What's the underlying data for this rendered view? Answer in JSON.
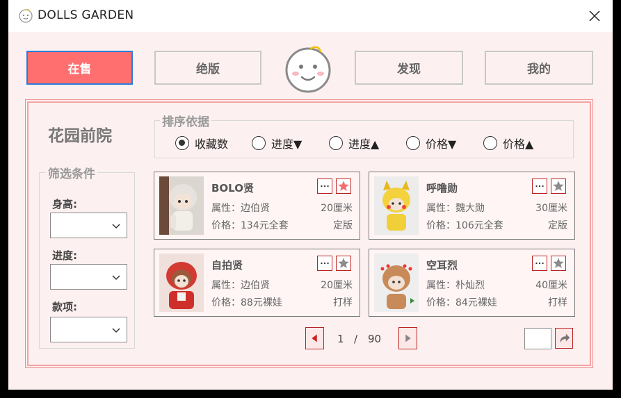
{
  "app": {
    "title": "DOLLS GARDEN"
  },
  "nav": {
    "on_sale": "在售",
    "out_of_print": "绝版",
    "discover": "发现",
    "mine": "我的"
  },
  "colors": {
    "accent": "#ff6f6f",
    "border_red": "#b22222",
    "panel_border": "#f5a3a3",
    "bg": "#fdf0f0"
  },
  "sidebar": {
    "title": "花园前院",
    "filter_legend": "筛选条件",
    "height_label": "身高:",
    "progress_label": "进度:",
    "type_label": "款项:"
  },
  "sort": {
    "legend": "排序依据",
    "options": [
      "收藏数",
      "进度▼",
      "进度▲",
      "价格▼",
      "价格▲"
    ],
    "selected": "收藏数"
  },
  "cards": [
    {
      "name": "BOLO贤",
      "attr": "属性：边伯贤",
      "size": "20厘米",
      "price": "价格：134元全套",
      "status": "定版",
      "favorited": true
    },
    {
      "name": "呼噜勋",
      "attr": "属性：魏大勋",
      "size": "30厘米",
      "price": "价格：106元全套",
      "status": "定版",
      "favorited": false
    },
    {
      "name": "自拍贤",
      "attr": "属性：边伯贤",
      "size": "20厘米",
      "price": "价格：88元裸娃",
      "status": "打样",
      "favorited": false
    },
    {
      "name": "空耳烈",
      "attr": "属性：朴灿烈",
      "size": "40厘米",
      "price": "价格：84元裸娃",
      "status": "打样",
      "favorited": false
    }
  ],
  "pagination": {
    "current": "1",
    "separator": "/",
    "total": "90"
  },
  "icons": [
    "doll-face-icon",
    "close-icon",
    "chevron-down-icon",
    "more-icon",
    "star-icon",
    "prev-arrow-icon",
    "next-arrow-icon",
    "jump-arrow-icon"
  ]
}
